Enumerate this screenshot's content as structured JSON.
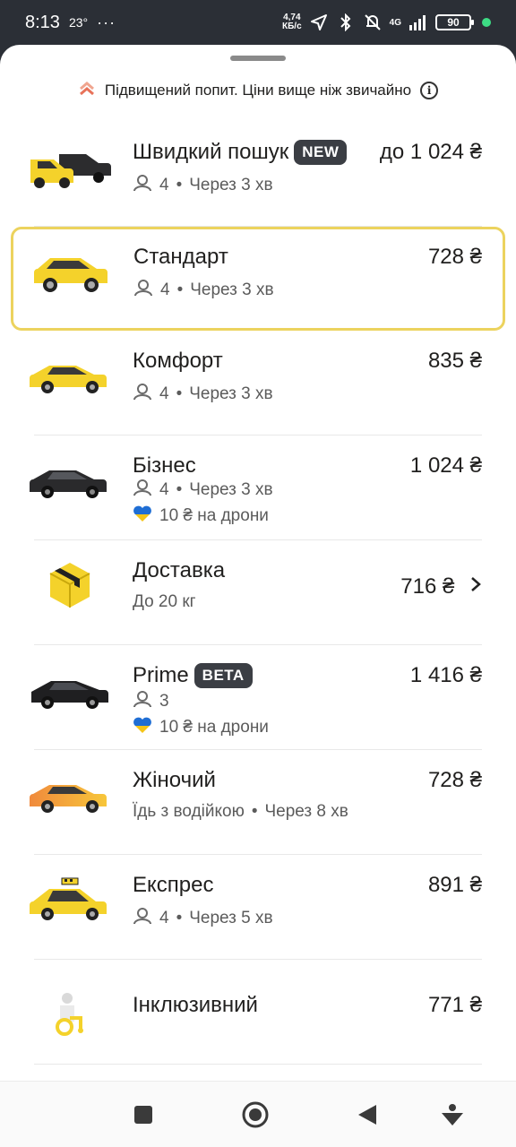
{
  "status": {
    "time": "8:13",
    "temp": "23°",
    "dots": "···",
    "speed_value": "4,74",
    "speed_unit": "КБ/с",
    "network": "4G",
    "battery": "90"
  },
  "surge": {
    "text": "Підвищений попит. Ціни вище ніж звичайно"
  },
  "colors": {
    "accent_yellow": "#ecd35e",
    "badge_bg": "#3b3e44",
    "car_yellow": "#f4d22b"
  },
  "tariffs": [
    {
      "name": "Швидкий пошук",
      "badge": "NEW",
      "price": "до 1 024 ₴",
      "seats": "4",
      "eta": "Через 3 хв",
      "icon": "dual-car-icon"
    },
    {
      "name": "Стандарт",
      "price": "728 ₴",
      "seats": "4",
      "eta": "Через 3 хв",
      "selected": true,
      "icon": "yellow-hatchback-icon"
    },
    {
      "name": "Комфорт",
      "price": "835 ₴",
      "seats": "4",
      "eta": "Через 3 хв",
      "icon": "yellow-sedan-icon"
    },
    {
      "name": "Бізнес",
      "price": "1 024 ₴",
      "seats": "4",
      "eta": "Через 3 хв",
      "donation": "10 ₴ на дрони",
      "icon": "black-sedan-icon"
    },
    {
      "name": "Доставка",
      "price": "716 ₴",
      "note": "До 20 кг",
      "icon": "delivery-box-icon"
    },
    {
      "name": "Prime",
      "badge": "BETA",
      "price": "1 416 ₴",
      "seats": "3",
      "donation": "10 ₴ на дрони",
      "icon": "black-premium-car-icon"
    },
    {
      "name": "Жіночий",
      "price": "728 ₴",
      "note": "Їдь з водійкою",
      "eta": "Через 8 хв",
      "icon": "orange-car-icon"
    },
    {
      "name": "Експрес",
      "price": "891 ₴",
      "seats": "4",
      "eta": "Через 5 хв",
      "icon": "taxi-car-icon"
    },
    {
      "name": "Інклюзивний",
      "price": "771 ₴",
      "icon": "wheelchair-person-icon"
    }
  ],
  "separator": "•"
}
